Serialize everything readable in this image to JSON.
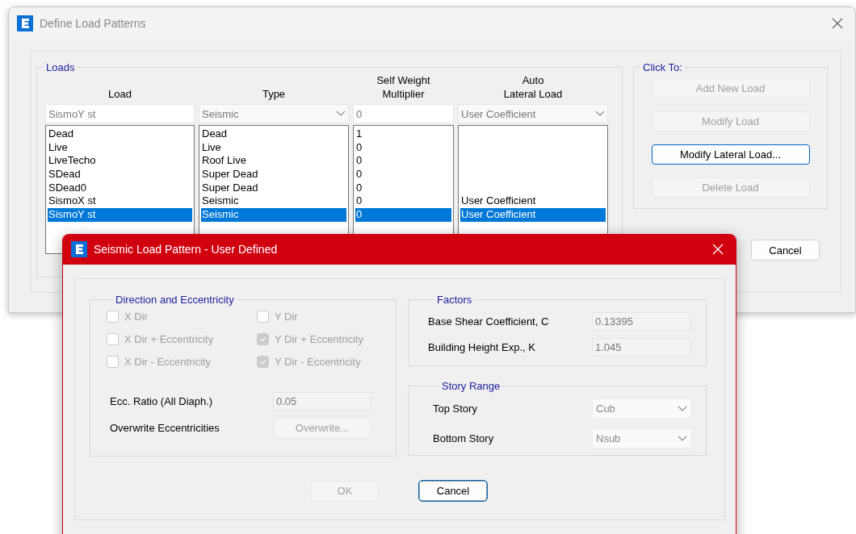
{
  "define_window": {
    "title": "Define Load Patterns",
    "loads_group": {
      "label": "Loads",
      "columns": [
        {
          "lines": [
            "Load"
          ]
        },
        {
          "lines": [
            "Type"
          ]
        },
        {
          "lines": [
            "Self Weight",
            "Multiplier"
          ]
        },
        {
          "lines": [
            "Auto",
            "Lateral Load"
          ]
        }
      ],
      "edit_row": {
        "load": "SismoY st",
        "type": "Seismic",
        "multiplier": "0",
        "auto_lateral": "User Coefficient"
      },
      "rows": [
        {
          "load": "Dead",
          "type": "Dead",
          "multiplier": "1",
          "selected": false
        },
        {
          "load": "Live",
          "type": "Live",
          "multiplier": "0",
          "selected": false
        },
        {
          "load": "LiveTecho",
          "type": "Roof Live",
          "multiplier": "0",
          "selected": false
        },
        {
          "load": "SDead",
          "type": "Super Dead",
          "multiplier": "0",
          "selected": false
        },
        {
          "load": "SDead0",
          "type": "Super Dead",
          "multiplier": "0",
          "selected": false
        },
        {
          "load": "SismoX st",
          "type": "Seismic",
          "multiplier": "0",
          "auto_lateral": "User Coefficient",
          "selected": false
        },
        {
          "load": "SismoY st",
          "type": "Seismic",
          "multiplier": "0",
          "auto_lateral": "User Coefficient",
          "selected": true
        }
      ]
    },
    "click_to": {
      "label": "Click To:",
      "buttons": [
        {
          "label": "Add New Load",
          "disabled": true,
          "focused": false
        },
        {
          "label": "Modify Load",
          "disabled": true,
          "focused": false
        },
        {
          "label": "Modify Lateral Load...",
          "disabled": false,
          "focused": true
        },
        {
          "label": "Delete Load",
          "disabled": true,
          "focused": false
        }
      ]
    },
    "cancel_button": "Cancel"
  },
  "seismic_window": {
    "title": "Seismic Load Pattern - User Defined",
    "direction_group": {
      "label": "Direction and Eccentricity",
      "disabled": true,
      "checkboxes": [
        {
          "label": "X Dir",
          "checked": false
        },
        {
          "label": "Y Dir",
          "checked": false
        },
        {
          "label": "X Dir + Eccentricity",
          "checked": false
        },
        {
          "label": "Y Dir + Eccentricity",
          "checked": true
        },
        {
          "label": "X Dir - Eccentricity",
          "checked": false
        },
        {
          "label": "Y Dir - Eccentricity",
          "checked": true
        }
      ],
      "ecc_ratio": {
        "label": "Ecc. Ratio (All Diaph.)",
        "value": "0.05"
      },
      "overwrite": {
        "label": "Overwrite Eccentricities",
        "button": "Overwrite..."
      }
    },
    "factors": {
      "label": "Factors",
      "fields": [
        {
          "label": "Base Shear Coefficient, C",
          "value": "0.13395"
        },
        {
          "label": "Building Height Exp., K",
          "value": "1.045"
        }
      ]
    },
    "story_range": {
      "label": "Story Range",
      "dropdowns": [
        {
          "label": "Top Story",
          "value": "Cub"
        },
        {
          "label": "Bottom Story",
          "value": "Nsub"
        }
      ]
    },
    "buttons": [
      {
        "label": "OK",
        "disabled": true,
        "focused": false
      },
      {
        "label": "Cancel",
        "disabled": false,
        "focused": true
      }
    ]
  }
}
